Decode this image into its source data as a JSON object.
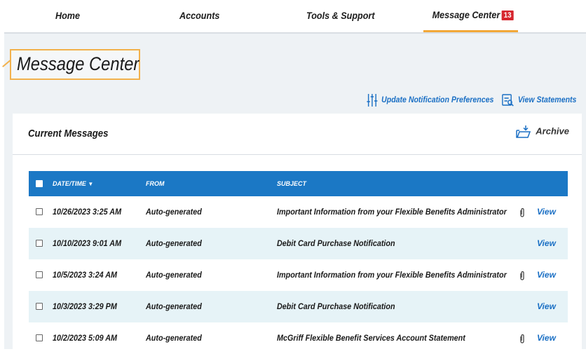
{
  "nav": {
    "items": [
      {
        "label": "Home"
      },
      {
        "label": "Accounts"
      },
      {
        "label": "Tools & Support"
      },
      {
        "label": "Message Center",
        "badge": "13",
        "active": true
      }
    ]
  },
  "page": {
    "title": "Message Center",
    "links": {
      "update_prefs": "Update Notification Preferences",
      "view_statements": "View Statements"
    }
  },
  "panel": {
    "title": "Current Messages",
    "archive_label": "Archive"
  },
  "table": {
    "columns": {
      "date": "Date/Time",
      "from": "From",
      "subject": "Subject"
    },
    "rows": [
      {
        "date": "10/26/2023 3:25 AM",
        "from": "Auto-generated",
        "subject": "Important Information from your Flexible Benefits Administrator",
        "attachment": true,
        "action": "View"
      },
      {
        "date": "10/10/2023 9:01 AM",
        "from": "Auto-generated",
        "subject": "Debit Card Purchase Notification",
        "attachment": false,
        "action": "View"
      },
      {
        "date": "10/5/2023 3:24 AM",
        "from": "Auto-generated",
        "subject": "Important Information from your Flexible Benefits Administrator",
        "attachment": true,
        "action": "View"
      },
      {
        "date": "10/3/2023 3:29 PM",
        "from": "Auto-generated",
        "subject": "Debit Card Purchase Notification",
        "attachment": false,
        "action": "View"
      },
      {
        "date": "10/2/2023 5:09 AM",
        "from": "Auto-generated",
        "subject": "McGriff Flexible Benefit Services Account Statement",
        "attachment": true,
        "action": "View"
      }
    ]
  },
  "colors": {
    "accent": "#f2a838",
    "header_blue": "#1b78c5",
    "link_blue": "#1a6fc4",
    "badge_red": "#d6262e",
    "row_alt": "#e6f3f7"
  }
}
